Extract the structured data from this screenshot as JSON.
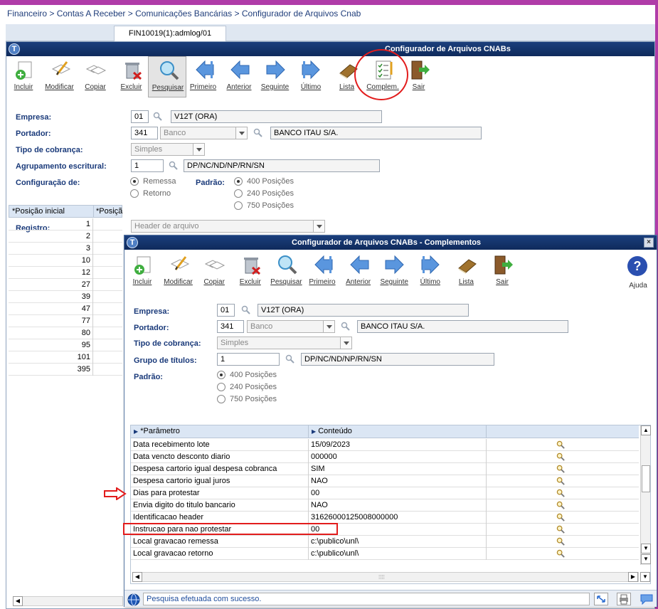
{
  "breadcrumb": "Financeiro > Contas A Receber > Comunicações Bancárias > Configurador de Arquivos Cnab",
  "tab_label": "FIN10019(1):admlog/01",
  "main": {
    "title": "Configurador de Arquivos CNABs",
    "toolbar": [
      {
        "label": "Incluir",
        "icon": "add-document-icon"
      },
      {
        "label": "Modificar",
        "icon": "edit-document-icon"
      },
      {
        "label": "Copiar",
        "icon": "copy-documents-icon"
      },
      {
        "label": "Excluir",
        "icon": "trash-icon"
      },
      {
        "label": "Pesquisar",
        "icon": "magnifier-icon"
      },
      {
        "label": "Primeiro",
        "icon": "first-arrow-icon"
      },
      {
        "label": "Anterior",
        "icon": "previous-arrow-icon"
      },
      {
        "label": "Seguinte",
        "icon": "next-arrow-icon"
      },
      {
        "label": "Último",
        "icon": "last-arrow-icon"
      },
      {
        "label": "Lista",
        "icon": "book-list-icon"
      },
      {
        "label": "Complem.",
        "icon": "checklist-icon"
      },
      {
        "label": "Sair",
        "icon": "exit-door-icon"
      }
    ],
    "empresa_label": "Empresa:",
    "empresa_code": "01",
    "empresa_name": "V12T (ORA)",
    "portador_label": "Portador:",
    "portador_code": "341",
    "portador_type": "Banco",
    "portador_name": "BANCO ITAU S/A.",
    "tipo_label": "Tipo de cobrança:",
    "tipo_value": "Simples",
    "agrup_label": "Agrupamento escritural:",
    "agrup_code": "1",
    "agrup_value": "DP/NC/ND/NP/RN/SN",
    "config_label": "Configuração de:",
    "config_options": [
      "Remessa",
      "Retorno"
    ],
    "padrao_label": "Padrão:",
    "padrao_options": [
      "400 Posições",
      "240 Posições",
      "750 Posições"
    ],
    "registro_label": "Registro:",
    "registro_value": "Header de arquivo",
    "grid_headers": [
      "*Posição inicial",
      "*Posiçã"
    ],
    "grid_values": [
      "1",
      "2",
      "3",
      "10",
      "12",
      "27",
      "39",
      "47",
      "77",
      "80",
      "95",
      "101",
      "395"
    ]
  },
  "dialog": {
    "title": "Configurador de Arquivos CNABs - Complementos",
    "toolbar": [
      {
        "label": "Incluir",
        "icon": "add-document-icon"
      },
      {
        "label": "Modificar",
        "icon": "edit-document-icon"
      },
      {
        "label": "Copiar",
        "icon": "copy-documents-icon"
      },
      {
        "label": "Excluir",
        "icon": "trash-icon"
      },
      {
        "label": "Pesquisar",
        "icon": "magnifier-icon"
      },
      {
        "label": "Primeiro",
        "icon": "first-arrow-icon"
      },
      {
        "label": "Anterior",
        "icon": "previous-arrow-icon"
      },
      {
        "label": "Seguinte",
        "icon": "next-arrow-icon"
      },
      {
        "label": "Último",
        "icon": "last-arrow-icon"
      },
      {
        "label": "Lista",
        "icon": "book-list-icon"
      },
      {
        "label": "Sair",
        "icon": "exit-door-icon"
      }
    ],
    "help_label": "Ajuda",
    "empresa_label": "Empresa:",
    "empresa_code": "01",
    "empresa_name": "V12T (ORA)",
    "portador_label": "Portador:",
    "portador_code": "341",
    "portador_type": "Banco",
    "portador_name": "BANCO ITAU S/A.",
    "tipo_label": "Tipo de cobrança:",
    "tipo_value": "Simples",
    "grupo_label": "Grupo de títulos:",
    "grupo_code": "1",
    "grupo_value": "DP/NC/ND/NP/RN/SN",
    "padrao_label": "Padrão:",
    "padrao_options": [
      "400 Posições",
      "240 Posições",
      "750 Posições"
    ],
    "grid_headers": [
      "*Parâmetro",
      "Conteúdo"
    ],
    "rows": [
      {
        "param": "Data recebimento lote",
        "value": "15/09/2023"
      },
      {
        "param": "Data vencto desconto diario",
        "value": "000000"
      },
      {
        "param": "Despesa cartorio igual despesa cobranca",
        "value": "SIM"
      },
      {
        "param": "Despesa cartorio igual juros",
        "value": "NAO"
      },
      {
        "param": "Dias para protestar",
        "value": "00"
      },
      {
        "param": "Envia digito do titulo bancario",
        "value": "NAO"
      },
      {
        "param": "Identificacao header",
        "value": "31626000125008000000"
      },
      {
        "param": "Instrucao para nao protestar",
        "value": "00"
      },
      {
        "param": "Local gravacao remessa",
        "value": "c:\\publico\\unl\\"
      },
      {
        "param": "Local gravacao retorno",
        "value": "c:\\publico\\unl\\"
      }
    ],
    "status": "Pesquisa efetuada com sucesso."
  },
  "colors": {
    "accent": "#b03ca8",
    "title_bar": "#1b3f7c",
    "annotation": "#e21c1c",
    "label": "#1a3a7a"
  }
}
